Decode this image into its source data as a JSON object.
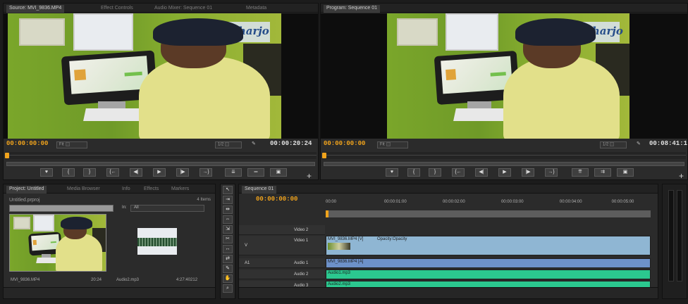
{
  "source_panel": {
    "tabs": [
      "Source: MVI_9836.MP4",
      "Effect Controls",
      "Audio Mixer: Sequence 01",
      "Metadata"
    ],
    "timecode_in": "00:00:00:00",
    "fit": "Fit",
    "resolution": "1/2",
    "duration": "00:00:20:24",
    "sign_text": "Raharjo"
  },
  "program_panel": {
    "tabs": [
      "Program: Sequence 01"
    ],
    "timecode_in": "00:00:00:00",
    "fit": "Fit",
    "resolution": "1/2",
    "duration": "00:08:41:1",
    "sign_text": "Raharjo"
  },
  "project_panel": {
    "tabs": [
      "Project: Untitled",
      "Media Browser",
      "Info",
      "Effects",
      "Markers"
    ],
    "path": "Untitled.prproj",
    "items": "4 Items",
    "in_label": "In:",
    "in_value": "All",
    "clip1": {
      "name": "MVI_9836.MP4",
      "duration": "20:24"
    },
    "clip2": {
      "name": "Audio2.mp3",
      "duration": "4:27:40212"
    }
  },
  "sequence_panel": {
    "tab": "Sequence 01",
    "timecode": "00:00:00:00",
    "ruler": [
      "00:00",
      "00:00:01:00",
      "00:00:02:00",
      "00:00:03:00",
      "00:00:04:00",
      "00:00:05:00"
    ],
    "tracks": {
      "video2": "Video 2",
      "video1": "Video 1",
      "audio1": "Audio 1",
      "audio2": "Audio 2",
      "audio3": "Audio 3"
    },
    "clip_video": "MVI_9836.MP4 [V]",
    "clip_video_opacity": "Opacity:Opacity",
    "clip_audio1": "MVI_9836.MP4 [A]",
    "clip_audio2": "Audio1.mp3",
    "clip_audio3": "Audio2.mp3",
    "track_labels": {
      "v": "V",
      "a1": "A1"
    }
  },
  "icons": [
    "marker-icon",
    "in-point-icon",
    "out-point-icon",
    "go-to-in-icon",
    "step-back-icon",
    "play-icon",
    "step-forward-icon",
    "go-to-out-icon",
    "insert-icon",
    "overwrite-icon",
    "export-frame-icon",
    "settings-icon",
    "add-icon"
  ],
  "colors": {
    "accent": "#f0a31c",
    "audio_clip": "#2bc88f",
    "video_clip": "#8fb6d3"
  }
}
